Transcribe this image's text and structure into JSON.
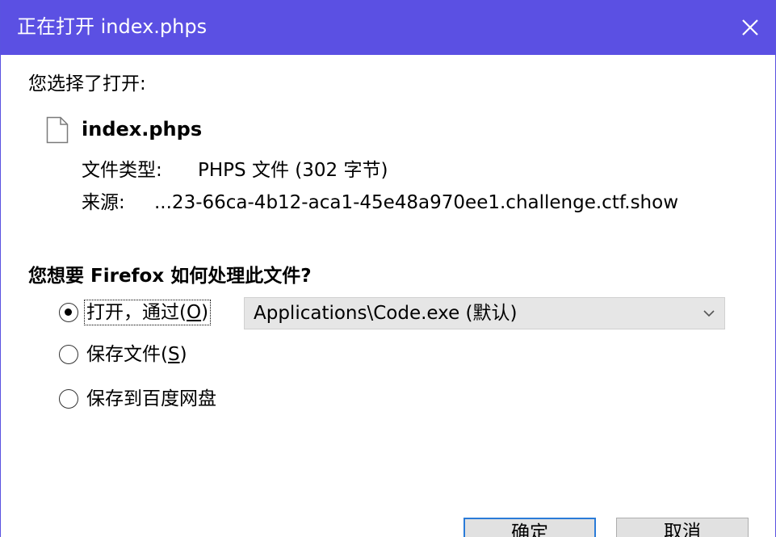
{
  "window": {
    "title": "正在打开 index.phps"
  },
  "intro": "您选择了打开:",
  "file": {
    "name": "index.phps",
    "type_label": "文件类型:",
    "type_value": "PHPS 文件 (302 字节)",
    "source_label": "来源:",
    "source_value": "...23-66ca-4b12-aca1-45e48a970ee1.challenge.ctf.show"
  },
  "question": "您想要 Firefox 如何处理此文件?",
  "options": {
    "open_with": {
      "label_pre": "打开，通过(",
      "accel": "O",
      "label_post": ")",
      "checked": true
    },
    "save": {
      "label_pre": "保存文件(",
      "accel": "S",
      "label_post": ")",
      "checked": false
    },
    "save_baidu": {
      "label": "保存到百度网盘",
      "checked": false
    }
  },
  "app_select": {
    "value": "Applications\\Code.exe (默认)"
  },
  "buttons": {
    "ok": "确定",
    "cancel": "取消"
  },
  "colors": {
    "titlebar": "#5b50e3",
    "primary_border": "#2a7bd8"
  },
  "icons": {
    "close": "close-icon",
    "file": "file-icon",
    "dropdown": "chevron-down-icon"
  }
}
